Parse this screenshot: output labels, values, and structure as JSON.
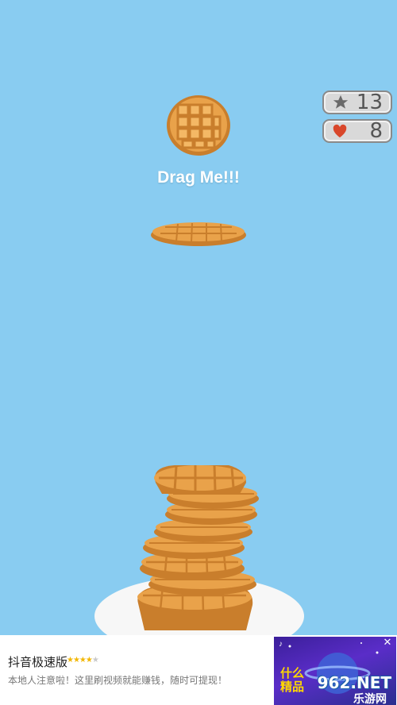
{
  "hud": {
    "stars": {
      "icon": "star-icon",
      "value": "13"
    },
    "lives": {
      "icon": "heart-icon",
      "value": "8"
    }
  },
  "game": {
    "instruction": "Drag Me!!!",
    "stack_count_visible": 8
  },
  "ad": {
    "title": "抖音极速版",
    "rating_filled": "★★★★",
    "rating_empty": "★",
    "description": "本地人注意啦！这里刷视频就能赚钱，随时可提现！",
    "close": "✕",
    "brand_main": "962.NET",
    "brand_sub": "乐游网",
    "side_text": "什么\n精品"
  },
  "colors": {
    "sky": "#89ccf1",
    "waffle": "#e9a24a",
    "waffle_dark": "#c97e2c",
    "plate": "#f7f7f7"
  }
}
